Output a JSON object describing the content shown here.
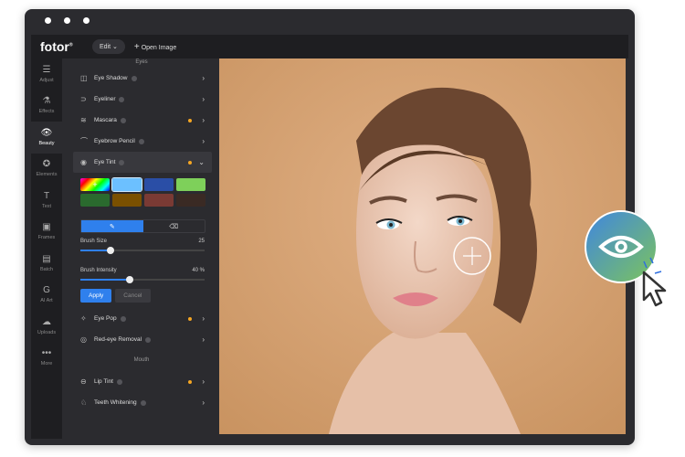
{
  "app": {
    "logo": "fotor",
    "logo_mark": "®"
  },
  "topbar": {
    "edit_label": "Edit",
    "edit_chevron": "⌄",
    "open_icon": "+",
    "open_label": "Open Image"
  },
  "sidebar": {
    "items": [
      {
        "label": "Adjust",
        "icon": "sliders-icon",
        "glyph": "☰"
      },
      {
        "label": "Effects",
        "icon": "flask-icon",
        "glyph": "⚗"
      },
      {
        "label": "Beauty",
        "icon": "eye-icon",
        "glyph": "👁"
      },
      {
        "label": "Elements",
        "icon": "star-circle-icon",
        "glyph": "✪"
      },
      {
        "label": "Text",
        "icon": "text-icon",
        "glyph": "T"
      },
      {
        "label": "Frames",
        "icon": "frame-icon",
        "glyph": "▣"
      },
      {
        "label": "Batch",
        "icon": "batch-icon",
        "glyph": "▤"
      },
      {
        "label": "AI Art",
        "icon": "ai-art-icon",
        "glyph": "G"
      },
      {
        "label": "Uploads",
        "icon": "cloud-upload-icon",
        "glyph": "☁"
      },
      {
        "label": "More",
        "icon": "more-icon",
        "glyph": "•••"
      }
    ],
    "active": "Beauty"
  },
  "panel": {
    "section_eyes": "Eyes",
    "eyes_items": [
      {
        "label": "Eye Shadow",
        "glyph": "◫",
        "dot": false
      },
      {
        "label": "Eyeliner",
        "glyph": "⊃",
        "dot": false
      },
      {
        "label": "Mascara",
        "glyph": "≋",
        "dot": true
      },
      {
        "label": "Eyebrow Pencil",
        "glyph": "⌒",
        "dot": false
      }
    ],
    "open_item": {
      "label": "Eye Tint",
      "glyph": "◉",
      "dot": true
    },
    "swatches": [
      "rainbow",
      "#6cc0ff",
      "#2a4ea6",
      "#7ed05a",
      "#2a6a2e",
      "#7a5000",
      "#7a3a34",
      "#3a2a24"
    ],
    "selected_swatch": "#6cc0ff",
    "tool_brush": "✎",
    "tool_eraser": "⌫",
    "brush_size_label": "Brush Size",
    "brush_size_value": "25",
    "brush_size_fraction": 0.24,
    "brush_intensity_label": "Brush Intensity",
    "brush_intensity_value": "40 %",
    "brush_intensity_fraction": 0.4,
    "apply_label": "Apply",
    "cancel_label": "Cancel",
    "more_eyes": [
      {
        "label": "Eye Pop",
        "glyph": "✧",
        "dot": true
      },
      {
        "label": "Red-eye Removal",
        "glyph": "◎",
        "dot": false
      }
    ],
    "section_mouth": "Mouth",
    "mouth_items": [
      {
        "label": "Lip Tint",
        "glyph": "⊖",
        "dot": true
      },
      {
        "label": "Teeth Whitening",
        "glyph": "♘",
        "dot": false
      }
    ]
  },
  "colors": {
    "accent": "#2f80ed",
    "dot": "#f5a623",
    "bg": "#d8a679"
  }
}
